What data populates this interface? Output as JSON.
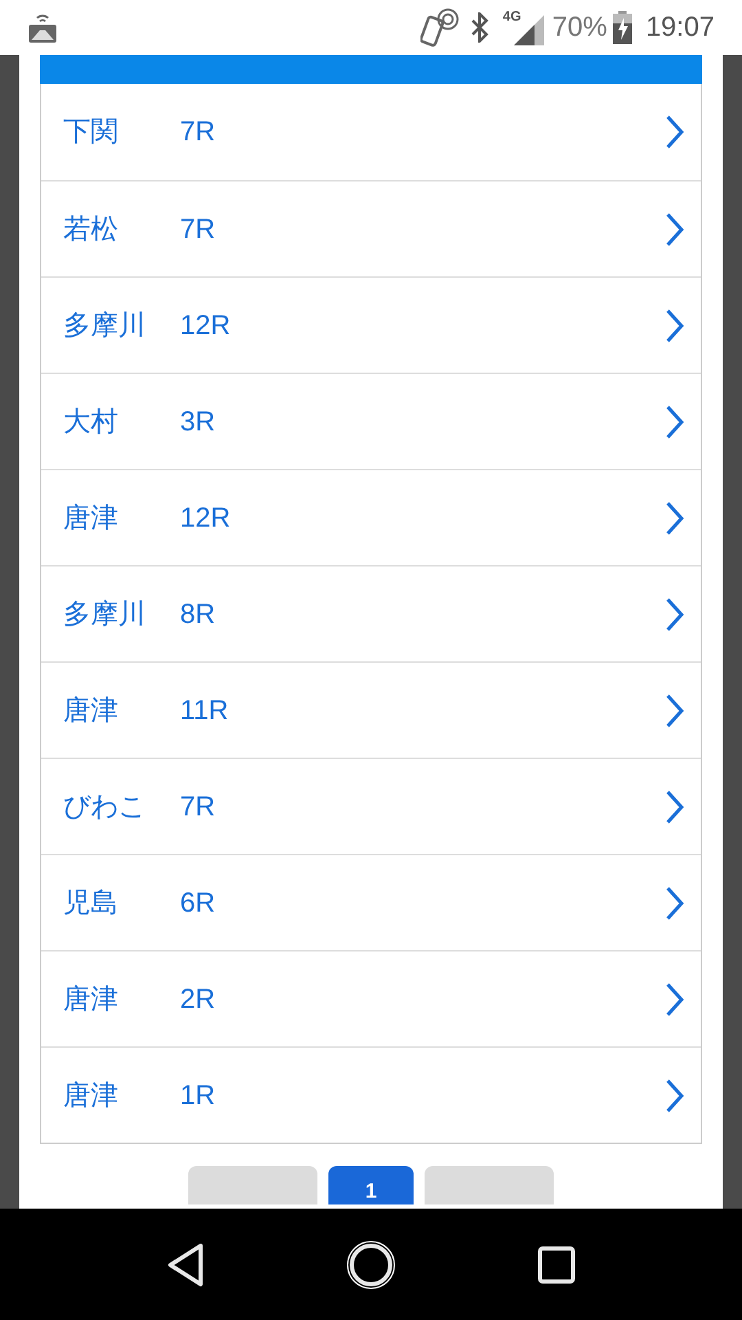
{
  "status_bar": {
    "network": "4G",
    "battery": "70%",
    "time": "19:07"
  },
  "races": [
    {
      "venue": "下関",
      "race": "7R"
    },
    {
      "venue": "若松",
      "race": "7R"
    },
    {
      "venue": "多摩川",
      "race": "12R"
    },
    {
      "venue": "大村",
      "race": "3R"
    },
    {
      "venue": "唐津",
      "race": "12R"
    },
    {
      "venue": "多摩川",
      "race": "8R"
    },
    {
      "venue": "唐津",
      "race": "11R"
    },
    {
      "venue": "びわこ",
      "race": "7R"
    },
    {
      "venue": "児島",
      "race": "6R"
    },
    {
      "venue": "唐津",
      "race": "2R"
    },
    {
      "venue": "唐津",
      "race": "1R"
    }
  ],
  "pagination": {
    "pages": [
      {
        "label": "1",
        "selected": true
      }
    ]
  }
}
